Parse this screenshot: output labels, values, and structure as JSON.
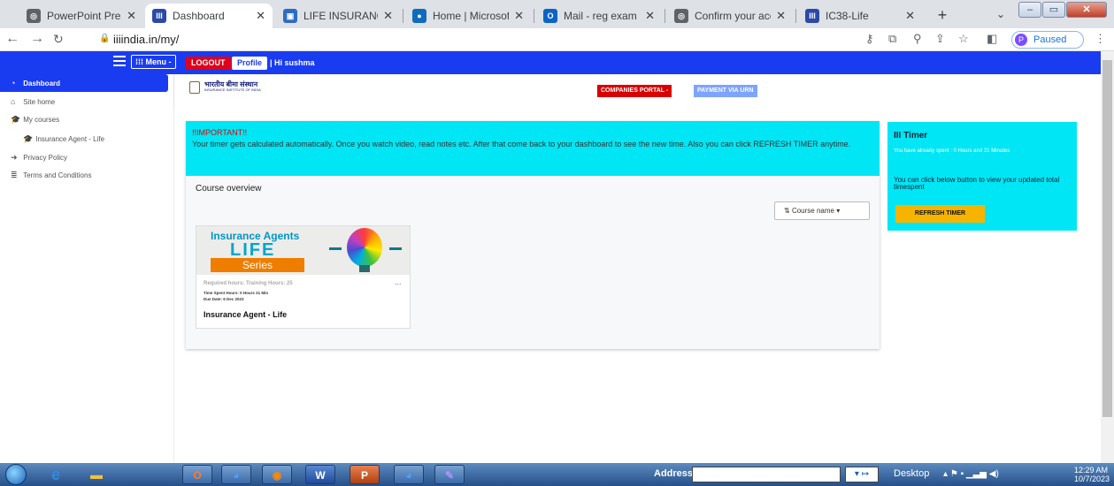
{
  "browser": {
    "tabs": [
      {
        "title": "PowerPoint Presen",
        "favicon_color": "#5f6368",
        "favicon": "◎",
        "active": false
      },
      {
        "title": "Dashboard",
        "favicon_color": "#2b4aa8",
        "favicon": "III",
        "active": true
      },
      {
        "title": "LIFE INSURANCE p",
        "favicon_color": "#2b6cc4",
        "favicon": "▣",
        "active": false
      },
      {
        "title": "Home | Microsoft",
        "favicon_color": "#0f6cbd",
        "favicon": "●",
        "active": false
      },
      {
        "title": "Mail - reg exam a",
        "favicon_color": "#0a64c8",
        "favicon": "O",
        "active": false
      },
      {
        "title": "Confirm your acco",
        "favicon_color": "#5f6368",
        "favicon": "◎",
        "active": false
      },
      {
        "title": "IC38-Life",
        "favicon_color": "#2b4aa8",
        "favicon": "III",
        "active": false
      }
    ],
    "url": "iiiindia.in/my/",
    "profile_status": "Paused",
    "profile_initial": "P"
  },
  "sitenav": {
    "menu_label": "Menu -",
    "logout_label": "LOGOUT",
    "profile_label": "Profile",
    "greeting": "| Hi sushma"
  },
  "sidebar": {
    "items": [
      {
        "label": "Dashboard",
        "icon": "◔"
      },
      {
        "label": "Site home",
        "icon": "⌂"
      },
      {
        "label": "My courses",
        "icon": "🎓"
      },
      {
        "label": "Insurance Agent - Life",
        "icon": "🎓"
      },
      {
        "label": "Privacy Policy",
        "icon": "➜"
      },
      {
        "label": "Terms and Conditions",
        "icon": "≣"
      }
    ]
  },
  "header": {
    "logo_hindi": "भारतीय बीमा संस्थान",
    "logo_english": "INSURANCE INSTITUTE OF INDIA",
    "companies_portal": "COMPANIES PORTAL  -",
    "payment_via_urn": "PAYMENT VIA URN"
  },
  "important": {
    "title": "!!IMPORTANT!!",
    "text": "Your timer gets calculated automatically. Once you watch video, read notes etc. After that come back to your dashboard to see the new time. Also you can click REFRESH TIMER anytime."
  },
  "overview": {
    "title": "Course overview",
    "sort_label": "Course name",
    "course": {
      "banner_line1": "Insurance Agents",
      "banner_line2": "LIFE",
      "banner_line3": "Series",
      "required_hours": "Required hours: Training Hours: 25",
      "time_spent": "Time Spent Hours: 0 Hours 21 Min",
      "due_date": "Due Date: 6 Dec 2023",
      "name": "Insurance Agent - Life",
      "menu": "..."
    }
  },
  "timer": {
    "title": "III Timer",
    "spent": "You have already spent : 0 Hours and 21 Minutes",
    "note": "You can click below button to view your updated total timespent",
    "button": "REFRESH TIMER"
  },
  "taskbar": {
    "address_label": "Address",
    "address_value": "",
    "desktop_label": "Desktop",
    "time": "12:29 AM",
    "date": "10/7/2023"
  },
  "colors": {
    "accent_blue": "#1a3cf0",
    "cyan": "#00e6f5",
    "logout_red": "#e0001b",
    "refresh_yellow": "#f6b400"
  }
}
